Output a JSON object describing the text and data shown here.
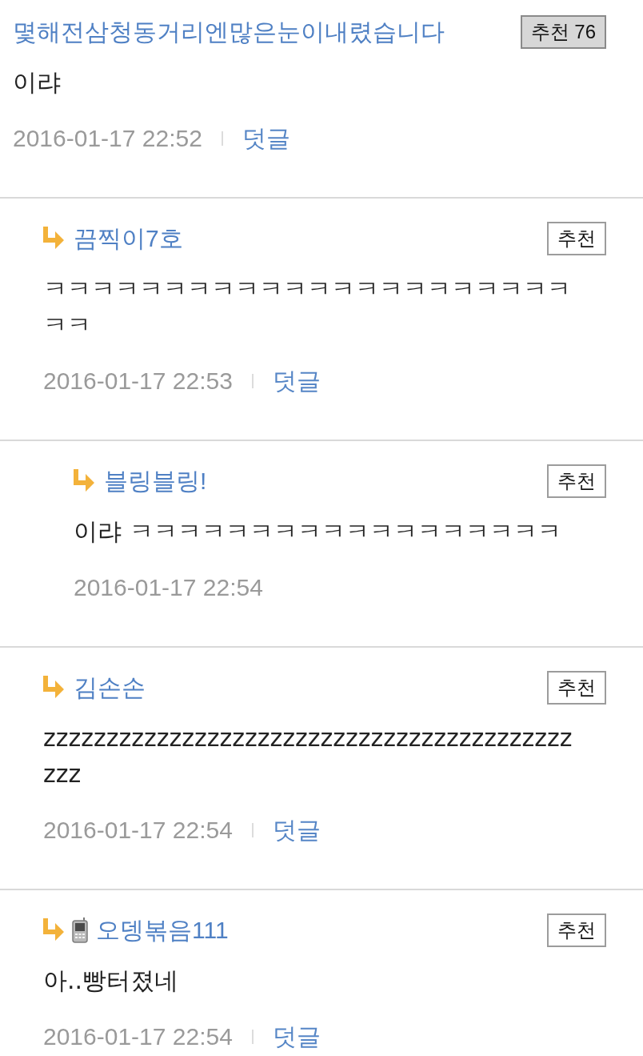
{
  "comments": [
    {
      "nickname": "몇해전삼청동거리엔많은눈이내렸습니다",
      "mobile": false,
      "recommend": {
        "label": "추천 76",
        "highlighted": true
      },
      "body": "이랴",
      "date": "2016-01-17 22:52",
      "reply_link": "덧글",
      "children": [
        {
          "nickname": "끔찍이7호",
          "mobile": false,
          "recommend": {
            "label": "추천",
            "highlighted": false
          },
          "body": "ㅋㅋㅋㅋㅋㅋㅋㅋㅋㅋㅋㅋㅋㅋㅋㅋㅋㅋㅋㅋㅋㅋㅋㅋ",
          "date": "2016-01-17 22:53",
          "reply_link": "덧글",
          "children": [
            {
              "nickname": "블링블링!",
              "mobile": false,
              "recommend": {
                "label": "추천",
                "highlighted": false
              },
              "body": "이랴 ㅋㅋㅋㅋㅋㅋㅋㅋㅋㅋㅋㅋㅋㅋㅋㅋㅋㅋ",
              "date": "2016-01-17 22:54"
            }
          ]
        },
        {
          "nickname": "김손손",
          "mobile": false,
          "recommend": {
            "label": "추천",
            "highlighted": false
          },
          "body": "zzzzzzzzzzzzzzzzzzzzzzzzzzzzzzzzzzzzzzzzzzzzz",
          "date": "2016-01-17 22:54",
          "reply_link": "덧글"
        },
        {
          "nickname": "오뎅볶음111",
          "mobile": true,
          "recommend": {
            "label": "추천",
            "highlighted": false
          },
          "body": "아..빵터졌네",
          "date": "2016-01-17 22:54",
          "reply_link": "덧글"
        }
      ]
    }
  ]
}
